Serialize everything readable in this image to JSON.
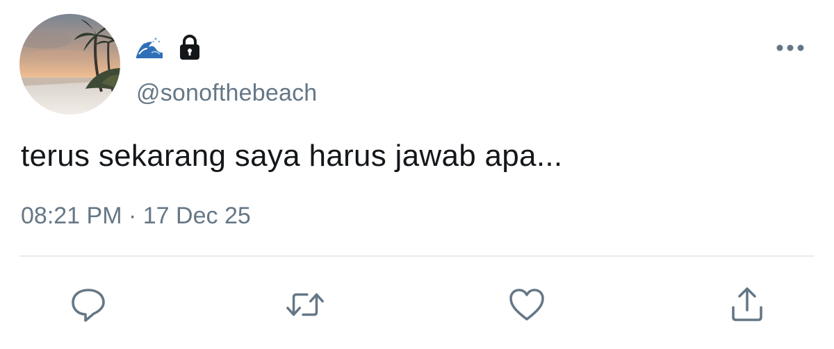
{
  "tweet": {
    "display_name_icons": [
      "water-wave-emoji-icon",
      "lock-icon"
    ],
    "handle": "@sonofthebeach",
    "text": "terus sekarang saya harus jawab apa...",
    "time": "08:21 PM",
    "separator": "·",
    "date": "17 Dec 25"
  },
  "actions": {
    "icons": [
      "reply-icon",
      "retweet-icon",
      "like-icon",
      "share-icon"
    ]
  },
  "header": {
    "more_icon": "more-options-icon"
  },
  "colors": {
    "text": "#14171a",
    "secondary": "#657786",
    "divider": "#e6ecf0"
  }
}
